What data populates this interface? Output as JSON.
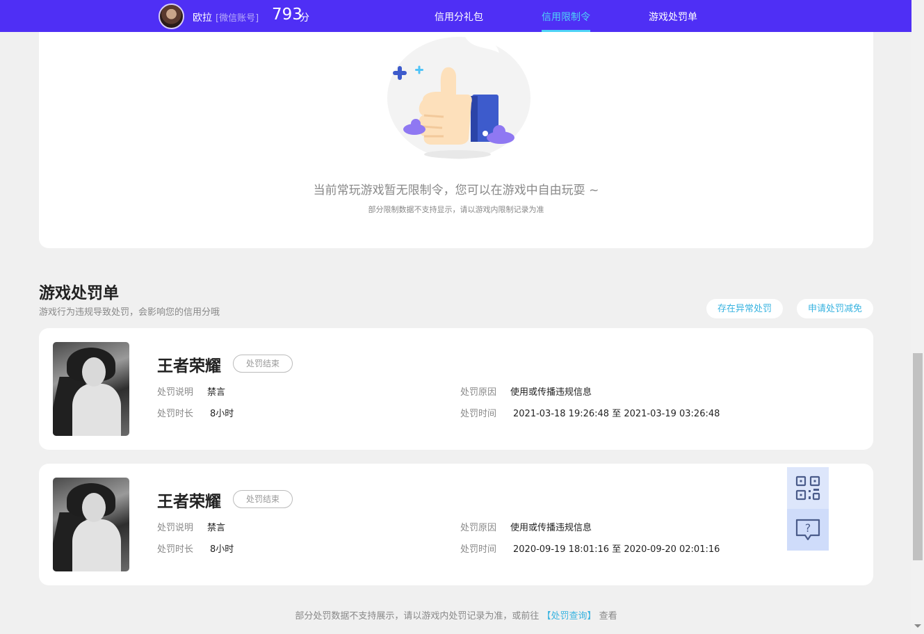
{
  "header": {
    "user_name": "欧拉",
    "account_type": "[微信账号]",
    "score": "793",
    "score_unit": "分",
    "nav": [
      {
        "label": "信用分礼包",
        "active": false
      },
      {
        "label": "信用限制令",
        "active": true
      },
      {
        "label": "游戏处罚单",
        "active": false
      }
    ],
    "accent_color": "#4f2ff5",
    "active_color": "#4fd3f7"
  },
  "restriction": {
    "illustration_icon": "thumbs-up-illustration",
    "empty_message": "当前常玩游戏暂无限制令，您可以在游戏中自由玩耍 ~",
    "empty_note": "部分限制数据不支持显示，请以游戏内限制记录为准"
  },
  "penalties": {
    "title": "游戏处罚单",
    "subtitle": "游戏行为违规导致处罚，会影响您的信用分哦",
    "actions": [
      {
        "label": "存在异常处罚"
      },
      {
        "label": "申请处罚减免"
      }
    ],
    "labels": {
      "desc": "处罚说明",
      "duration": "处罚时长",
      "reason": "处罚原因",
      "time": "处罚时间"
    },
    "records": [
      {
        "game": "王者荣耀",
        "status": "处罚结束",
        "desc": "禁言",
        "duration": "8小时",
        "reason": "使用或传播违规信息",
        "time": "2021-03-18 19:26:48 至 2021-03-19 03:26:48"
      },
      {
        "game": "王者荣耀",
        "status": "处罚结束",
        "desc": "禁言",
        "duration": "8小时",
        "reason": "使用或传播违规信息",
        "time": "2020-09-19 18:01:16 至 2020-09-20 02:01:16"
      }
    ],
    "footer_before": "部分处罚数据不支持展示，请以游戏内处罚记录为准，或前往",
    "footer_link": "【处罚查询】",
    "footer_after": "查看"
  },
  "floating": {
    "qr_icon": "qr-code-icon",
    "help_icon": "help-chat-icon"
  }
}
